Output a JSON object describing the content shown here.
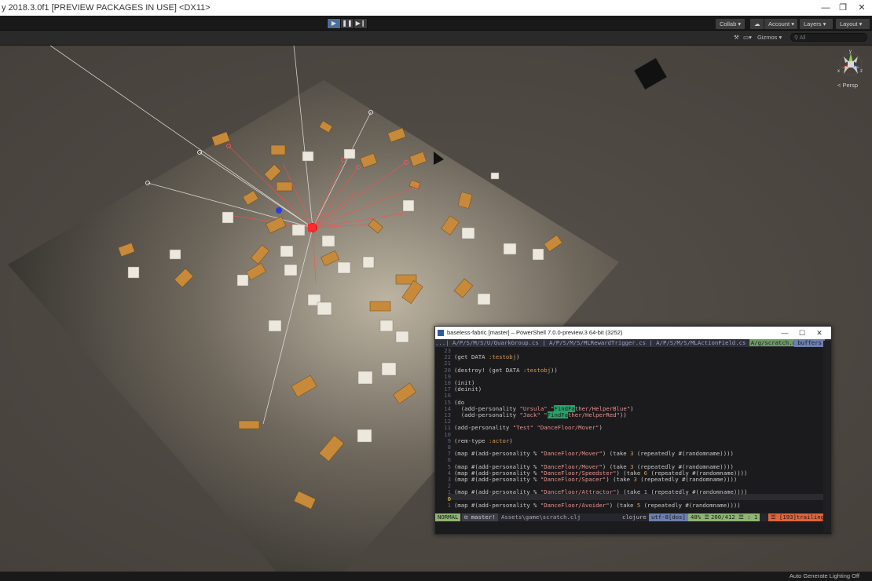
{
  "window": {
    "title": "y 2018.3.0f1 [PREVIEW PACKAGES IN USE] <DX11>",
    "minimize": "—",
    "restore": "❐",
    "close": "✕"
  },
  "toolbar": {
    "play": "▶",
    "pause": "❚❚",
    "step": "▶❙",
    "collab": "Collab ▾",
    "cloud": "☁",
    "account": "Account",
    "layers": "Layers",
    "layout": "Layout"
  },
  "scene_toolbar": {
    "tools": "⚒",
    "fx": "▭▾",
    "gizmos": "Gizmos",
    "search_placeholder": "All"
  },
  "gizmo": {
    "persp_label": "< Persp",
    "axis_y": "y",
    "axis_z": "z",
    "axis_x": "x"
  },
  "statusbar": {
    "message": "Auto Generate Lighting Off"
  },
  "terminal": {
    "title": "baseless-fabric [master] – PowerShell 7.0.0-preview.3 64-bit (3252)",
    "tabs_text": "...| A/P/S/M/S/U/QuarkGroup.cs | A/P/S/M/S/MLRewardTrigger.cs | A/P/S/M/S/MLActionField.cs ",
    "tab_selected": "A/g/scratch.clj",
    "buffers": "buffers",
    "lines": [
      {
        "n": "23",
        "parts": [
          {
            "t": ""
          }
        ]
      },
      {
        "n": "22",
        "parts": [
          {
            "t": "(get DATA "
          },
          {
            "t": ":testobj",
            "c": "k"
          },
          {
            "t": ")"
          }
        ]
      },
      {
        "n": "21",
        "parts": [
          {
            "t": ""
          }
        ]
      },
      {
        "n": "20",
        "parts": [
          {
            "t": "(destroy! (get DATA "
          },
          {
            "t": ":testobj",
            "c": "k"
          },
          {
            "t": "))"
          }
        ]
      },
      {
        "n": "19",
        "parts": [
          {
            "t": ""
          }
        ]
      },
      {
        "n": "18",
        "parts": [
          {
            "t": "(init)"
          }
        ]
      },
      {
        "n": "17",
        "parts": [
          {
            "t": "(deinit)"
          }
        ]
      },
      {
        "n": "16",
        "parts": [
          {
            "t": ""
          }
        ]
      },
      {
        "n": "15",
        "parts": [
          {
            "t": "(do"
          }
        ]
      },
      {
        "n": "14",
        "parts": [
          {
            "t": "  (add-personality "
          },
          {
            "t": "\"Ursula\"",
            "c": "s"
          },
          {
            "t": " "
          },
          {
            "t": "\"",
            "c": "s"
          },
          {
            "t": "FindFa",
            "c": "hl"
          },
          {
            "t": "ther/HelperBlue\"",
            "c": "s"
          },
          {
            "t": ")"
          }
        ]
      },
      {
        "n": "13",
        "parts": [
          {
            "t": "  (add-personality "
          },
          {
            "t": "\"Jack\"",
            "c": "s"
          },
          {
            "t": " "
          },
          {
            "t": "\"",
            "c": "s"
          },
          {
            "t": "FindFa",
            "c": "hl"
          },
          {
            "t": "ther/HelperRed\"",
            "c": "s"
          },
          {
            "t": "))"
          }
        ]
      },
      {
        "n": "12",
        "parts": [
          {
            "t": ""
          }
        ]
      },
      {
        "n": "11",
        "parts": [
          {
            "t": "(add-personality "
          },
          {
            "t": "\"Test\"",
            "c": "s"
          },
          {
            "t": " "
          },
          {
            "t": "\"DanceFloor/Mover\"",
            "c": "s"
          },
          {
            "t": ")"
          }
        ]
      },
      {
        "n": "10",
        "parts": [
          {
            "t": ""
          }
        ]
      },
      {
        "n": "9",
        "parts": [
          {
            "t": "(rem-type "
          },
          {
            "t": ":actor",
            "c": "k"
          },
          {
            "t": ")"
          }
        ]
      },
      {
        "n": "8",
        "parts": [
          {
            "t": ""
          }
        ]
      },
      {
        "n": "7",
        "parts": [
          {
            "t": "(map #(add-personality % "
          },
          {
            "t": "\"DanceFloor/Mover\"",
            "c": "s"
          },
          {
            "t": ") (take "
          },
          {
            "t": "3",
            "c": "k"
          },
          {
            "t": " (repeatedly #(randomname))))"
          }
        ]
      },
      {
        "n": "6",
        "parts": [
          {
            "t": ""
          }
        ]
      },
      {
        "n": "5",
        "parts": [
          {
            "t": "(map #(add-personality % "
          },
          {
            "t": "\"DanceFloor/Mover\"",
            "c": "s"
          },
          {
            "t": ") (take "
          },
          {
            "t": "3",
            "c": "k"
          },
          {
            "t": " (repeatedly #(randomname))))"
          }
        ]
      },
      {
        "n": "4",
        "parts": [
          {
            "t": "(map #(add-personality % "
          },
          {
            "t": "\"DanceFloor/Speedster\"",
            "c": "s"
          },
          {
            "t": ") (take "
          },
          {
            "t": "6",
            "c": "k"
          },
          {
            "t": " (repeatedly #(randomname))))"
          }
        ]
      },
      {
        "n": "3",
        "parts": [
          {
            "t": "(map #(add-personality % "
          },
          {
            "t": "\"DanceFloor/Spacer\"",
            "c": "s"
          },
          {
            "t": ") (take "
          },
          {
            "t": "3",
            "c": "k"
          },
          {
            "t": " (repeatedly #(randomname))))"
          }
        ]
      },
      {
        "n": "2",
        "parts": [
          {
            "t": ""
          }
        ]
      },
      {
        "n": "1",
        "parts": [
          {
            "t": "(map #(add-personality % "
          },
          {
            "t": "\"DanceFloor/Attractor\"",
            "c": "s"
          },
          {
            "t": ") (take "
          },
          {
            "t": "1",
            "c": "k"
          },
          {
            "t": " (repeatedly #(randomname))))"
          }
        ]
      },
      {
        "n": "0",
        "cur": true,
        "parts": [
          {
            "t": ""
          }
        ]
      },
      {
        "n": "1",
        "parts": [
          {
            "t": "(map #(add-personality % "
          },
          {
            "t": "\"DanceFloor/Avoider\"",
            "c": "s"
          },
          {
            "t": ") (take "
          },
          {
            "t": "5",
            "c": "k"
          },
          {
            "t": " (repeatedly #(randomname))))"
          }
        ]
      }
    ],
    "status": {
      "mode": "NORMAL",
      "branch": "⊟ master!",
      "file": "Assets\\game\\scratch.clj",
      "filetype": "clojure",
      "encoding": "utf-8[dos]",
      "percent": "48% ☰",
      "position": "200/412 ☰ :  1",
      "trailing": "☰ [193]trailing"
    },
    "colors": {
      "mode_bg": "#8fb573",
      "trailing_bg": "#e0643c",
      "percent_bg": "#8fb573",
      "encoding_bg": "#6d7fae"
    }
  }
}
